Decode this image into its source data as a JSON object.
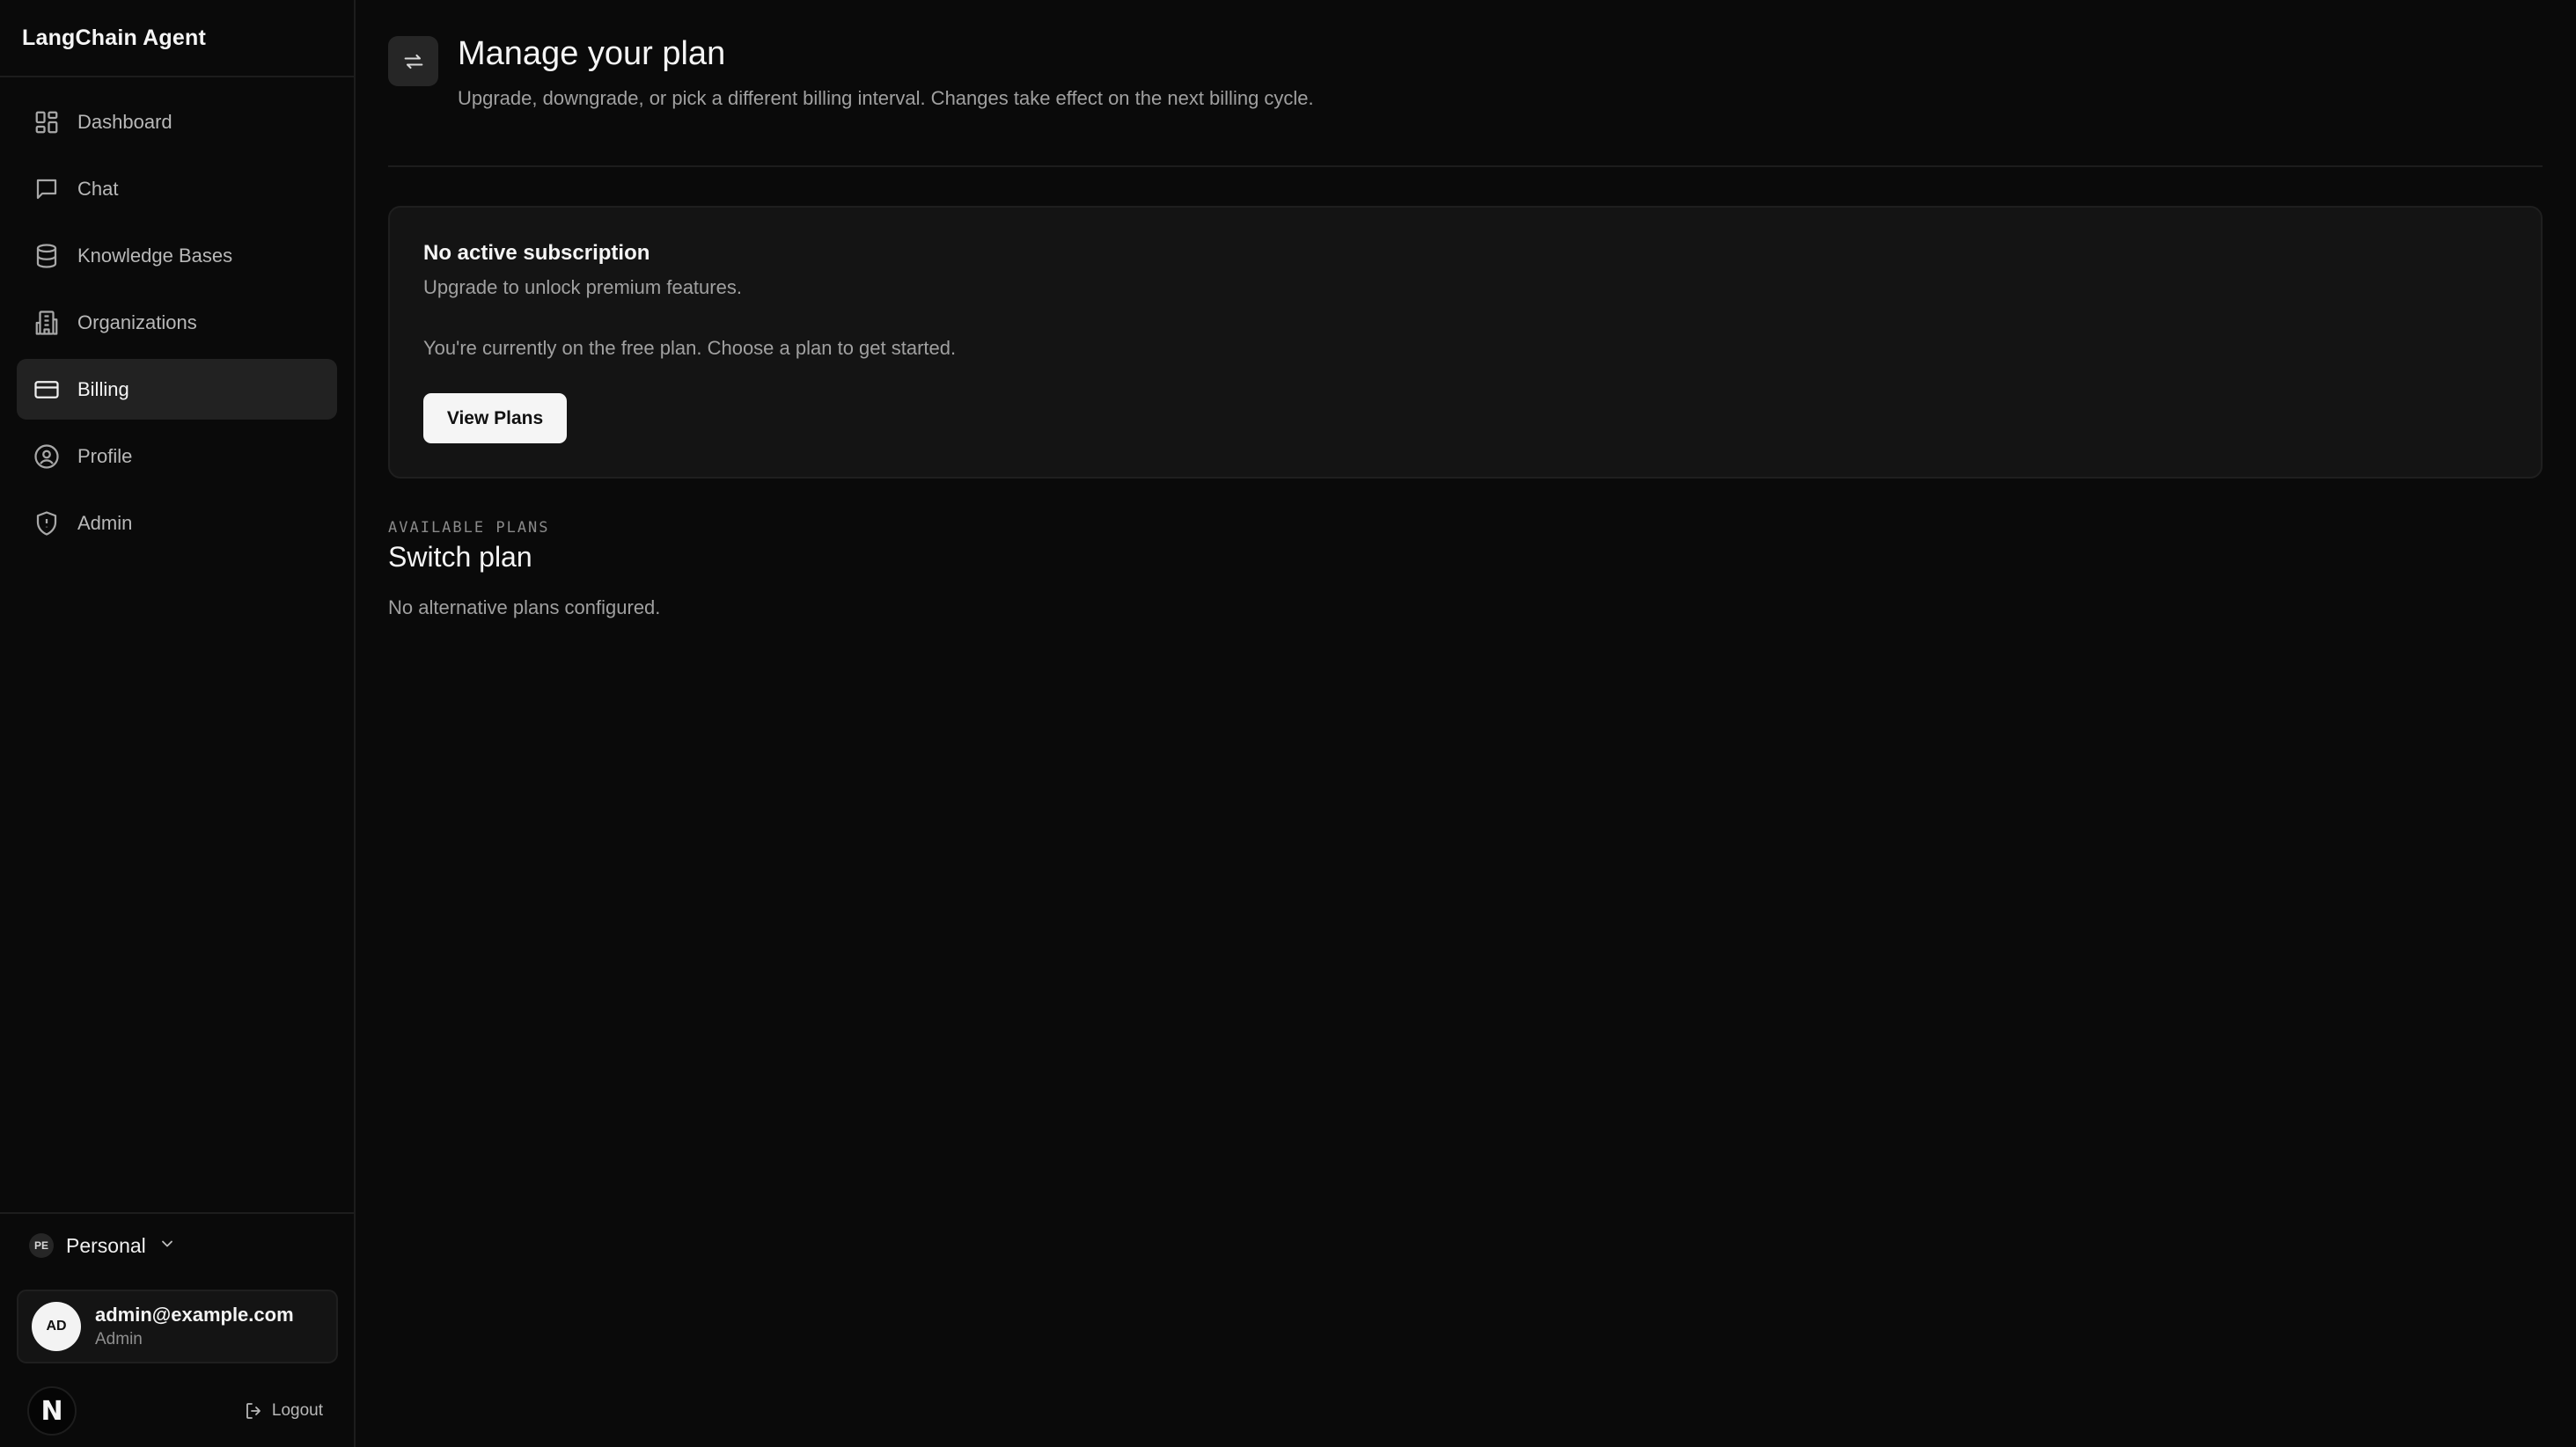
{
  "app": {
    "title": "LangChain Agent"
  },
  "sidebar": {
    "items": [
      {
        "label": "Dashboard",
        "icon": "dashboard-icon",
        "active": false
      },
      {
        "label": "Chat",
        "icon": "chat-icon",
        "active": false
      },
      {
        "label": "Knowledge Bases",
        "icon": "database-icon",
        "active": false
      },
      {
        "label": "Organizations",
        "icon": "building-icon",
        "active": false
      },
      {
        "label": "Billing",
        "icon": "credit-card-icon",
        "active": true
      },
      {
        "label": "Profile",
        "icon": "user-circle-icon",
        "active": false
      },
      {
        "label": "Admin",
        "icon": "shield-icon",
        "active": false
      }
    ]
  },
  "footer": {
    "org_initials": "PE",
    "org_name": "Personal",
    "user_initials": "AD",
    "user_email": "admin@example.com",
    "user_role": "Admin",
    "theme_glyph": "N",
    "logout_label": "Logout"
  },
  "header": {
    "title": "Manage your plan",
    "subtitle": "Upgrade, downgrade, or pick a different billing interval. Changes take effect on the next billing cycle."
  },
  "subscription": {
    "title": "No active subscription",
    "description": "Upgrade to unlock premium features.",
    "body": "You're currently on the free plan. Choose a plan to get started.",
    "button_label": "View Plans"
  },
  "plans": {
    "eyebrow": "AVAILABLE PLANS",
    "title": "Switch plan",
    "empty_message": "No alternative plans configured."
  },
  "colors": {
    "background": "#0a0a0a",
    "sidebar_active": "#222222",
    "card": "#141414",
    "primary_button": "#f5f5f5"
  }
}
